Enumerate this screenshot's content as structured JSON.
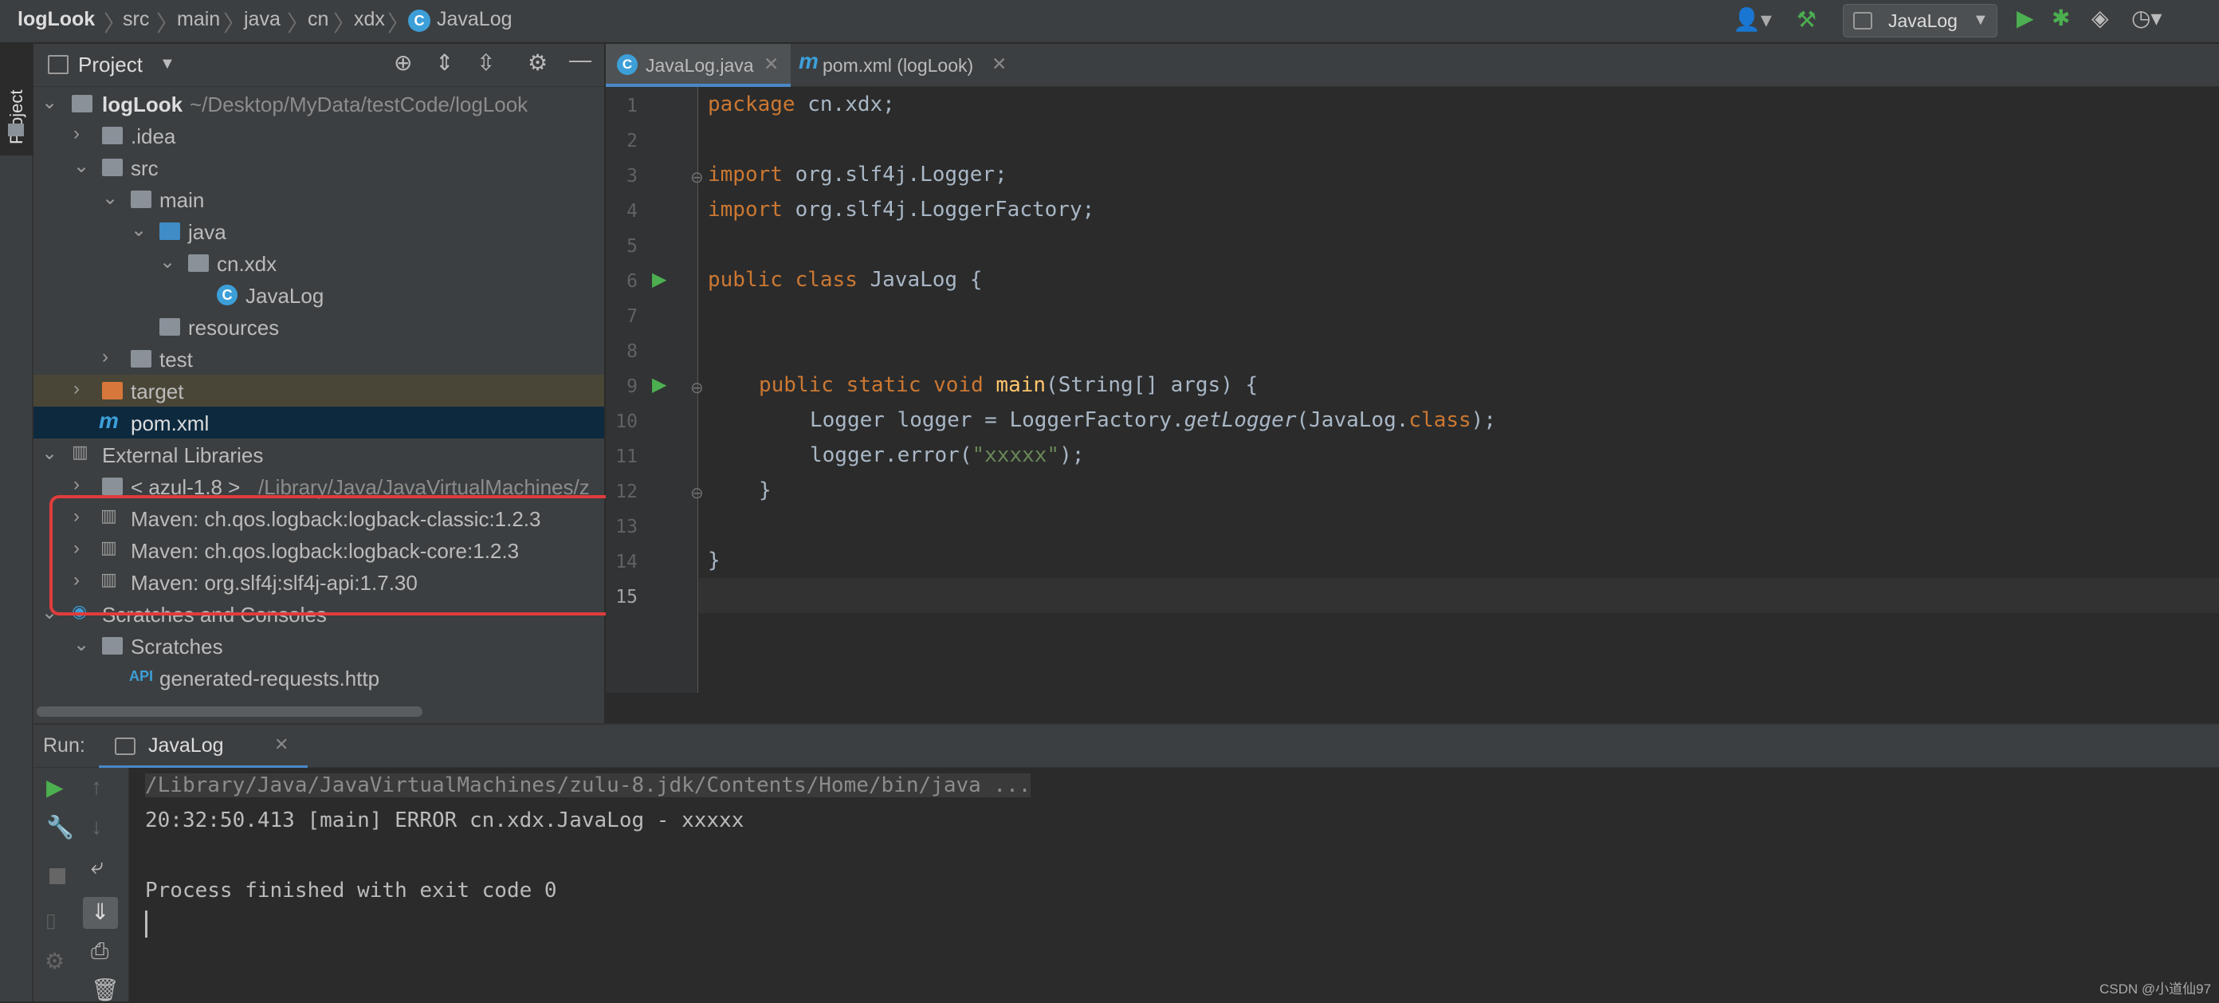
{
  "breadcrumbs": [
    "logLook",
    "src",
    "main",
    "java",
    "cn",
    "xdx",
    "JavaLog"
  ],
  "run_config": "JavaLog",
  "left_strip": {
    "project_label": "Project"
  },
  "project_panel": {
    "title": "Project"
  },
  "tree": [
    {
      "label": "logLook",
      "path": "~/Desktop/MyData/testCode/logLook"
    },
    {
      "label": ".idea"
    },
    {
      "label": "src"
    },
    {
      "label": "main"
    },
    {
      "label": "java"
    },
    {
      "label": "cn.xdx"
    },
    {
      "label": "JavaLog"
    },
    {
      "label": "resources"
    },
    {
      "label": "test"
    },
    {
      "label": "target"
    },
    {
      "label": "pom.xml"
    },
    {
      "label": "External Libraries"
    },
    {
      "label": "< azul-1.8 >",
      "path": "/Library/Java/JavaVirtualMachines/z"
    },
    {
      "label": "Maven: ch.qos.logback:logback-classic:1.2.3"
    },
    {
      "label": "Maven: ch.qos.logback:logback-core:1.2.3"
    },
    {
      "label": "Maven: org.slf4j:slf4j-api:1.7.30"
    },
    {
      "label": "Scratches and Consoles"
    },
    {
      "label": "Scratches"
    },
    {
      "label": "generated-requests.http"
    }
  ],
  "editor_tabs": [
    {
      "label": "JavaLog.java",
      "active": true
    },
    {
      "label": "pom.xml (logLook)",
      "active": false
    }
  ],
  "line_numbers": [
    "1",
    "2",
    "3",
    "4",
    "5",
    "6",
    "7",
    "8",
    "9",
    "10",
    "11",
    "12",
    "13",
    "14",
    "15"
  ],
  "code": {
    "l1": {
      "kw": "package",
      "rest": " cn.xdx;"
    },
    "l3": {
      "kw": "import",
      "rest": " org.slf4j.Logger;"
    },
    "l4": {
      "kw": "import",
      "rest": " org.slf4j.LoggerFactory;"
    },
    "l6": {
      "kw1": "public",
      "kw2": " class",
      "rest": " JavaLog {"
    },
    "l9": {
      "kw": "public static void",
      "fn": " main",
      "rest": "(String[] args) {"
    },
    "l10": {
      "a": "Logger logger = LoggerFactory.",
      "fn": "getLogger",
      "b": "(JavaLog.",
      "kw": "class",
      "c": ");"
    },
    "l11": {
      "a": "logger.error(",
      "str": "\"xxxxx\"",
      "b": ");"
    },
    "l12": "}",
    "l14": "}"
  },
  "run": {
    "label": "Run:",
    "tab": "JavaLog"
  },
  "console": [
    "/Library/Java/JavaVirtualMachines/zulu-8.jdk/Contents/Home/bin/java ...",
    "20:32:50.413 [main] ERROR cn.xdx.JavaLog - xxxxx",
    "",
    "Process finished with exit code 0"
  ],
  "watermark": "CSDN @小道仙97",
  "colors": {
    "highlight_box": "#e03c3c",
    "selection": "#0d293e",
    "keyword": "#cc7832",
    "string": "#6a8759",
    "method": "#ffc66d"
  }
}
